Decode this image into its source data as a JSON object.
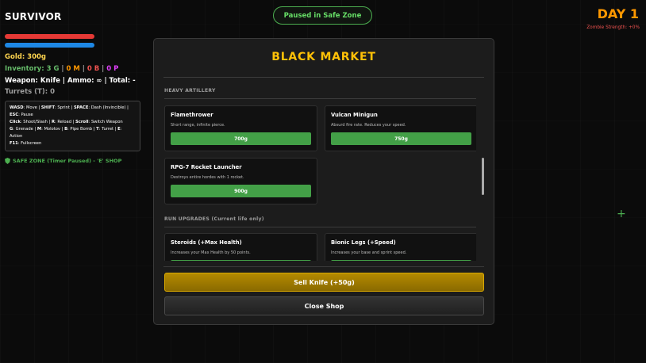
{
  "hud": {
    "player_name": "SURVIVOR",
    "gold": "Gold: 300g",
    "inventory": {
      "prefix": "Inventory: ",
      "grenades": "3 G",
      "molotovs": "0 M",
      "pipe_bombs": "0 B",
      "sep": " | ",
      "p": "0 P"
    },
    "weapon": "Weapon: Knife | Ammo: ∞ | Total: -",
    "turrets": "Turrets (T): 0",
    "health_level": 1.0,
    "energy_level": 1.0,
    "controls": [
      {
        "key": "WASD",
        "action": ": Move | "
      },
      {
        "key": "SHIFT",
        "action": ": Sprint | "
      },
      {
        "key": "SPACE",
        "action": ": Dash (Invincible) | "
      },
      {
        "key": "ESC",
        "action": ": Pause"
      },
      {
        "key": "Click",
        "action": ": Shoot/Slash | "
      },
      {
        "key": "R",
        "action": ": Reload | "
      },
      {
        "key": "Scroll",
        "action": ": Switch Weapon"
      },
      {
        "key": "G",
        "action": ": Grenade | "
      },
      {
        "key": "M",
        "action": ": Molotov | "
      },
      {
        "key": "B",
        "action": ": Pipe Bomb | "
      },
      {
        "key": "T",
        "action": ": Turret | "
      },
      {
        "key": "E",
        "action": ": Action"
      },
      {
        "key": "F11",
        "action": ": Fullscreen"
      }
    ],
    "safe_zone": "SAFE ZONE (Timer Paused) - 'E' SHOP",
    "colors": {
      "health": "#e53935",
      "energy": "#1e88e5",
      "gold": "#ffd54f",
      "grenades": "#66bb6a",
      "molotovs": "#ff9800",
      "pipe_bombs": "#ef5350",
      "p": "#e040fb"
    }
  },
  "status": {
    "pill": "Paused in Safe Zone",
    "day": "DAY 1",
    "zombie_strength": "Zombie Strength: +0%"
  },
  "shop": {
    "title": "BLACK MARKET",
    "sections": [
      {
        "heading": "HEAVY ARTILLERY",
        "items": [
          {
            "name": "Flamethrower",
            "desc": "Short range, infinite pierce.",
            "price": "700g"
          },
          {
            "name": "Vulcan Minigun",
            "desc": "Absurd fire rate. Reduces your speed.",
            "price": "750g"
          },
          {
            "name": "RPG-7 Rocket Launcher",
            "desc": "Destroys entire hordes with 1 rocket.",
            "price": "900g"
          }
        ]
      },
      {
        "heading": "RUN UPGRADES (Current life only)",
        "items": [
          {
            "name": "Steroids (+Max Health)",
            "desc": "Increases your Max Health by 50 points.",
            "price": ""
          },
          {
            "name": "Bionic Legs (+Speed)",
            "desc": "Increases your base and sprint speed.",
            "price": ""
          }
        ]
      }
    ],
    "sell_button": "Sell Knife (+50g)",
    "close_button": "Close Shop"
  }
}
